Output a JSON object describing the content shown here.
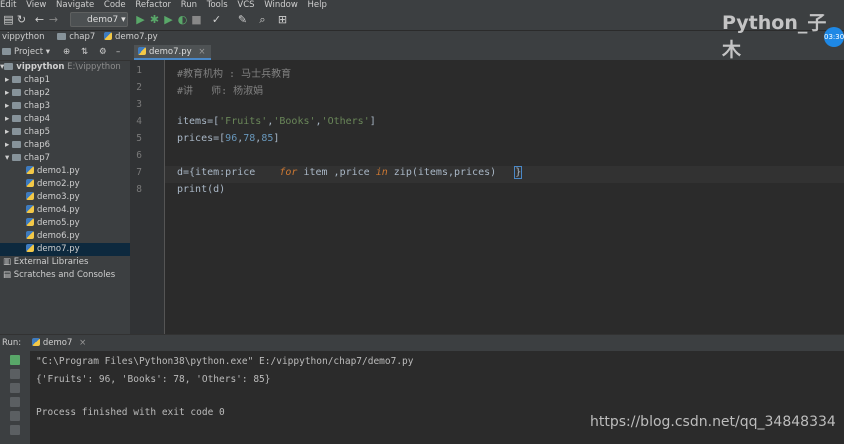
{
  "menu": [
    "Edit",
    "View",
    "Navigate",
    "Code",
    "Refactor",
    "Run",
    "Tools",
    "VCS",
    "Window",
    "Help"
  ],
  "toolbar": {
    "run_config": "demo7"
  },
  "breadcrumbs": [
    "vippython",
    "chap7",
    "demo7.py"
  ],
  "project_panel": {
    "title": "Project",
    "root": {
      "name": "vippython",
      "path": "E:\\vippython"
    },
    "items": [
      {
        "label": "chap1",
        "type": "folder"
      },
      {
        "label": "chap2",
        "type": "folder"
      },
      {
        "label": "chap3",
        "type": "folder"
      },
      {
        "label": "chap4",
        "type": "folder"
      },
      {
        "label": "chap5",
        "type": "folder"
      },
      {
        "label": "chap6",
        "type": "folder"
      },
      {
        "label": "chap7",
        "type": "folder"
      },
      {
        "label": "demo1.py",
        "type": "file"
      },
      {
        "label": "demo2.py",
        "type": "file"
      },
      {
        "label": "demo3.py",
        "type": "file"
      },
      {
        "label": "demo4.py",
        "type": "file"
      },
      {
        "label": "demo5.py",
        "type": "file"
      },
      {
        "label": "demo6.py",
        "type": "file"
      },
      {
        "label": "demo7.py",
        "type": "file",
        "selected": true
      },
      {
        "label": "External Libraries",
        "type": "lib"
      },
      {
        "label": "Scratches and Consoles",
        "type": "lib"
      }
    ]
  },
  "editor": {
    "tab": "demo7.py",
    "line_numbers": [
      "1",
      "2",
      "3",
      "4",
      "5",
      "6",
      "7",
      "8"
    ],
    "lines": {
      "l1": "#教育机构 : 马士兵教育",
      "l2": "#讲   师: 杨淑娟",
      "l4a": "items=[",
      "l4s1": "'Fruits'",
      "l4c": ",",
      "l4s2": "'Books'",
      "l4s3": "'Others'",
      "l4e": "]",
      "l5a": "prices=[",
      "l5n1": "96",
      "l5n2": "78",
      "l5n3": "85",
      "l5e": "]",
      "l7a": "d={item:price",
      "l7for": "for",
      "l7b": " item ,price ",
      "l7in": "in",
      "l7c": " zip(items,prices)",
      "l7e": "}",
      "l8": "print(d)"
    }
  },
  "run_panel": {
    "label": "Run:",
    "tab": "demo7"
  },
  "console": {
    "cmd": "\"C:\\Program Files\\Python38\\python.exe\" E:/vippython/chap7/demo7.py",
    "output": "{'Fruits': 96, 'Books': 78, 'Others': 85}",
    "exit": "Process finished with exit code 0"
  },
  "overlay": {
    "watermark": "Python_子木",
    "badge": "03:30",
    "url": "https://blog.csdn.net/qq_34848334"
  },
  "colors": {
    "accent": "#4a88c7",
    "bg": "#2b2b2b",
    "panel": "#3c3f41",
    "string": "#6a8759",
    "number": "#6897bb",
    "keyword": "#cc7832"
  }
}
